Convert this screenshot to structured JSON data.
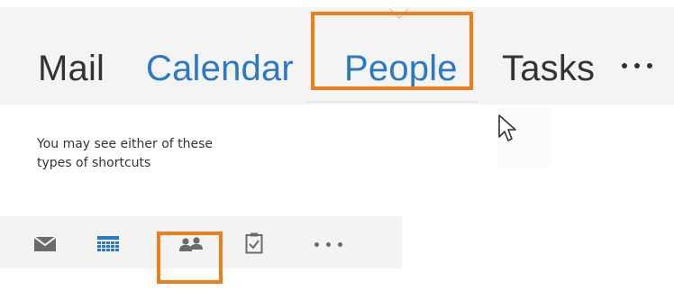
{
  "colors": {
    "nav_inactive": "#333333",
    "nav_active": "#2b78c5",
    "highlight": "#f07d1a",
    "icon_gray": "#6b6b6b",
    "icon_blue": "#2b78c5",
    "text": "#333333"
  },
  "nav": {
    "items": [
      {
        "label": "Mail"
      },
      {
        "label": "Calendar"
      },
      {
        "label": "People"
      },
      {
        "label": "Tasks"
      }
    ],
    "more_icon": "more-dots-icon",
    "caret_icon": "caret-down-icon"
  },
  "note": {
    "line1": "You may see either of these",
    "line2": "types of shortcuts"
  },
  "shortcuts": {
    "icons": [
      "mail-envelope-icon",
      "calendar-grid-icon",
      "people-icon",
      "tasks-clipboard-icon",
      "more-dots-icon"
    ]
  },
  "cursor_icon": "mouse-pointer-icon"
}
